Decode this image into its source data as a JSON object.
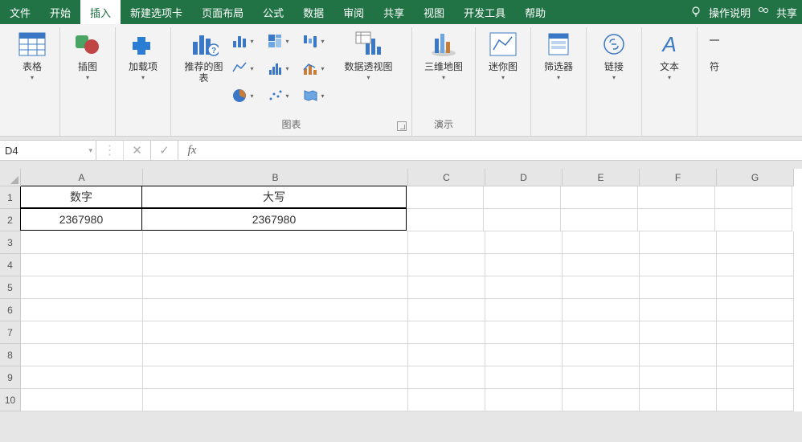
{
  "menu": {
    "tabs": [
      "文件",
      "开始",
      "插入",
      "新建选项卡",
      "页面布局",
      "公式",
      "数据",
      "审阅",
      "共享",
      "视图",
      "开发工具",
      "帮助"
    ],
    "active_index": 2,
    "tell_me": "操作说明",
    "share": "共享"
  },
  "ribbon": {
    "tables": {
      "label": "表格"
    },
    "illus": {
      "label": "插图"
    },
    "addins": {
      "label": "加载项"
    },
    "charts": {
      "group": "图表",
      "recommended": "推荐的图表",
      "pivotchart": "数据透视图"
    },
    "tours": {
      "group": "演示",
      "map3d": "三维地图"
    },
    "sparklines": {
      "label": "迷你图"
    },
    "filters": {
      "label": "筛选器"
    },
    "links": {
      "label": "链接"
    },
    "text": {
      "label": "文本"
    },
    "symbols": {
      "label": "符"
    }
  },
  "formula_bar": {
    "name": "D4",
    "value": ""
  },
  "grid": {
    "cols": [
      "A",
      "B",
      "C",
      "D",
      "E",
      "F",
      "G"
    ],
    "rows": 10,
    "cells": {
      "A1": "数字",
      "B1": "大写",
      "A2": "2367980",
      "B2": "2367980"
    }
  }
}
